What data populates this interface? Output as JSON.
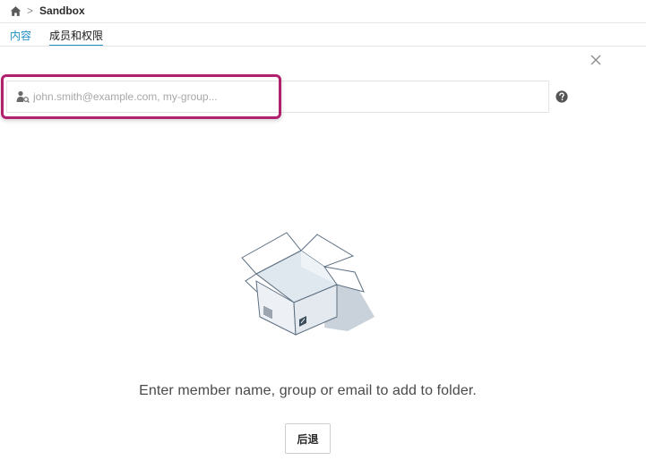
{
  "breadcrumb": {
    "home_icon": "home-icon",
    "separator": ">",
    "current": "Sandbox"
  },
  "tabs": [
    {
      "label": "内容",
      "active": false
    },
    {
      "label": "成员和权限",
      "active": true
    }
  ],
  "search": {
    "icon": "user-search-icon",
    "placeholder": "john.smith@example.com, my-group..."
  },
  "help_icon": "help-icon",
  "close_icon": "close-icon",
  "empty_state": {
    "illustration": "open-box-icon",
    "message": "Enter member name, group or email to add to folder."
  },
  "footer": {
    "back_label": "后退"
  },
  "colors": {
    "accent": "#1f8fc4",
    "highlight": "#b2216d"
  }
}
